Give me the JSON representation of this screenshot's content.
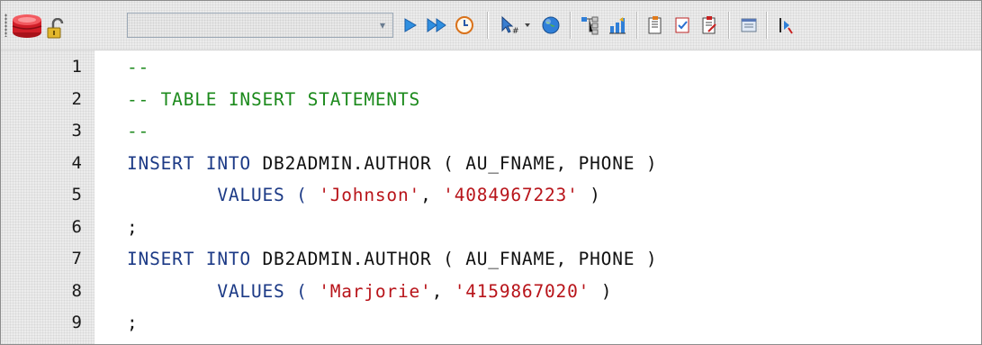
{
  "toolbar": {
    "icons": [
      "database-icon",
      "lock-icon",
      "run-icon",
      "run-all-icon",
      "clock-icon",
      "cursor-add-icon",
      "globe-icon",
      "tree-icon",
      "chart-icon",
      "doc-icon",
      "check-doc-icon",
      "doc-edit-icon",
      "panel-icon",
      "step-icon"
    ],
    "combo_value": ""
  },
  "editor": {
    "line_numbers": [
      "1",
      "2",
      "3",
      "4",
      "5",
      "6",
      "7",
      "8",
      "9"
    ],
    "lines": [
      {
        "tokens": [
          {
            "t": "--",
            "c": "cm"
          }
        ]
      },
      {
        "tokens": [
          {
            "t": "-- TABLE INSERT STATEMENTS",
            "c": "cm"
          }
        ]
      },
      {
        "tokens": [
          {
            "t": "--",
            "c": "cm"
          }
        ]
      },
      {
        "tokens": [
          {
            "t": "INSERT INTO ",
            "c": "kw"
          },
          {
            "t": "DB2ADMIN.AUTHOR ( AU_FNAME, PHONE )",
            "c": "pl"
          }
        ]
      },
      {
        "tokens": [
          {
            "t": "        VALUES ( ",
            "c": "kw"
          },
          {
            "t": "'Johnson'",
            "c": "st"
          },
          {
            "t": ", ",
            "c": "pl"
          },
          {
            "t": "'4084967223'",
            "c": "st"
          },
          {
            "t": " )",
            "c": "pl"
          }
        ]
      },
      {
        "tokens": [
          {
            "t": ";",
            "c": "pl"
          }
        ]
      },
      {
        "tokens": [
          {
            "t": "INSERT INTO ",
            "c": "kw"
          },
          {
            "t": "DB2ADMIN.AUTHOR ( AU_FNAME, PHONE )",
            "c": "pl"
          }
        ]
      },
      {
        "tokens": [
          {
            "t": "        VALUES ( ",
            "c": "kw"
          },
          {
            "t": "'Marjorie'",
            "c": "st"
          },
          {
            "t": ", ",
            "c": "pl"
          },
          {
            "t": "'4159867020'",
            "c": "st"
          },
          {
            "t": " )",
            "c": "pl"
          }
        ]
      },
      {
        "tokens": [
          {
            "t": ";",
            "c": "pl"
          }
        ]
      }
    ]
  },
  "colors": {
    "keyword": "#1c3a86",
    "comment": "#1c8a1c",
    "string": "#b8141a"
  }
}
